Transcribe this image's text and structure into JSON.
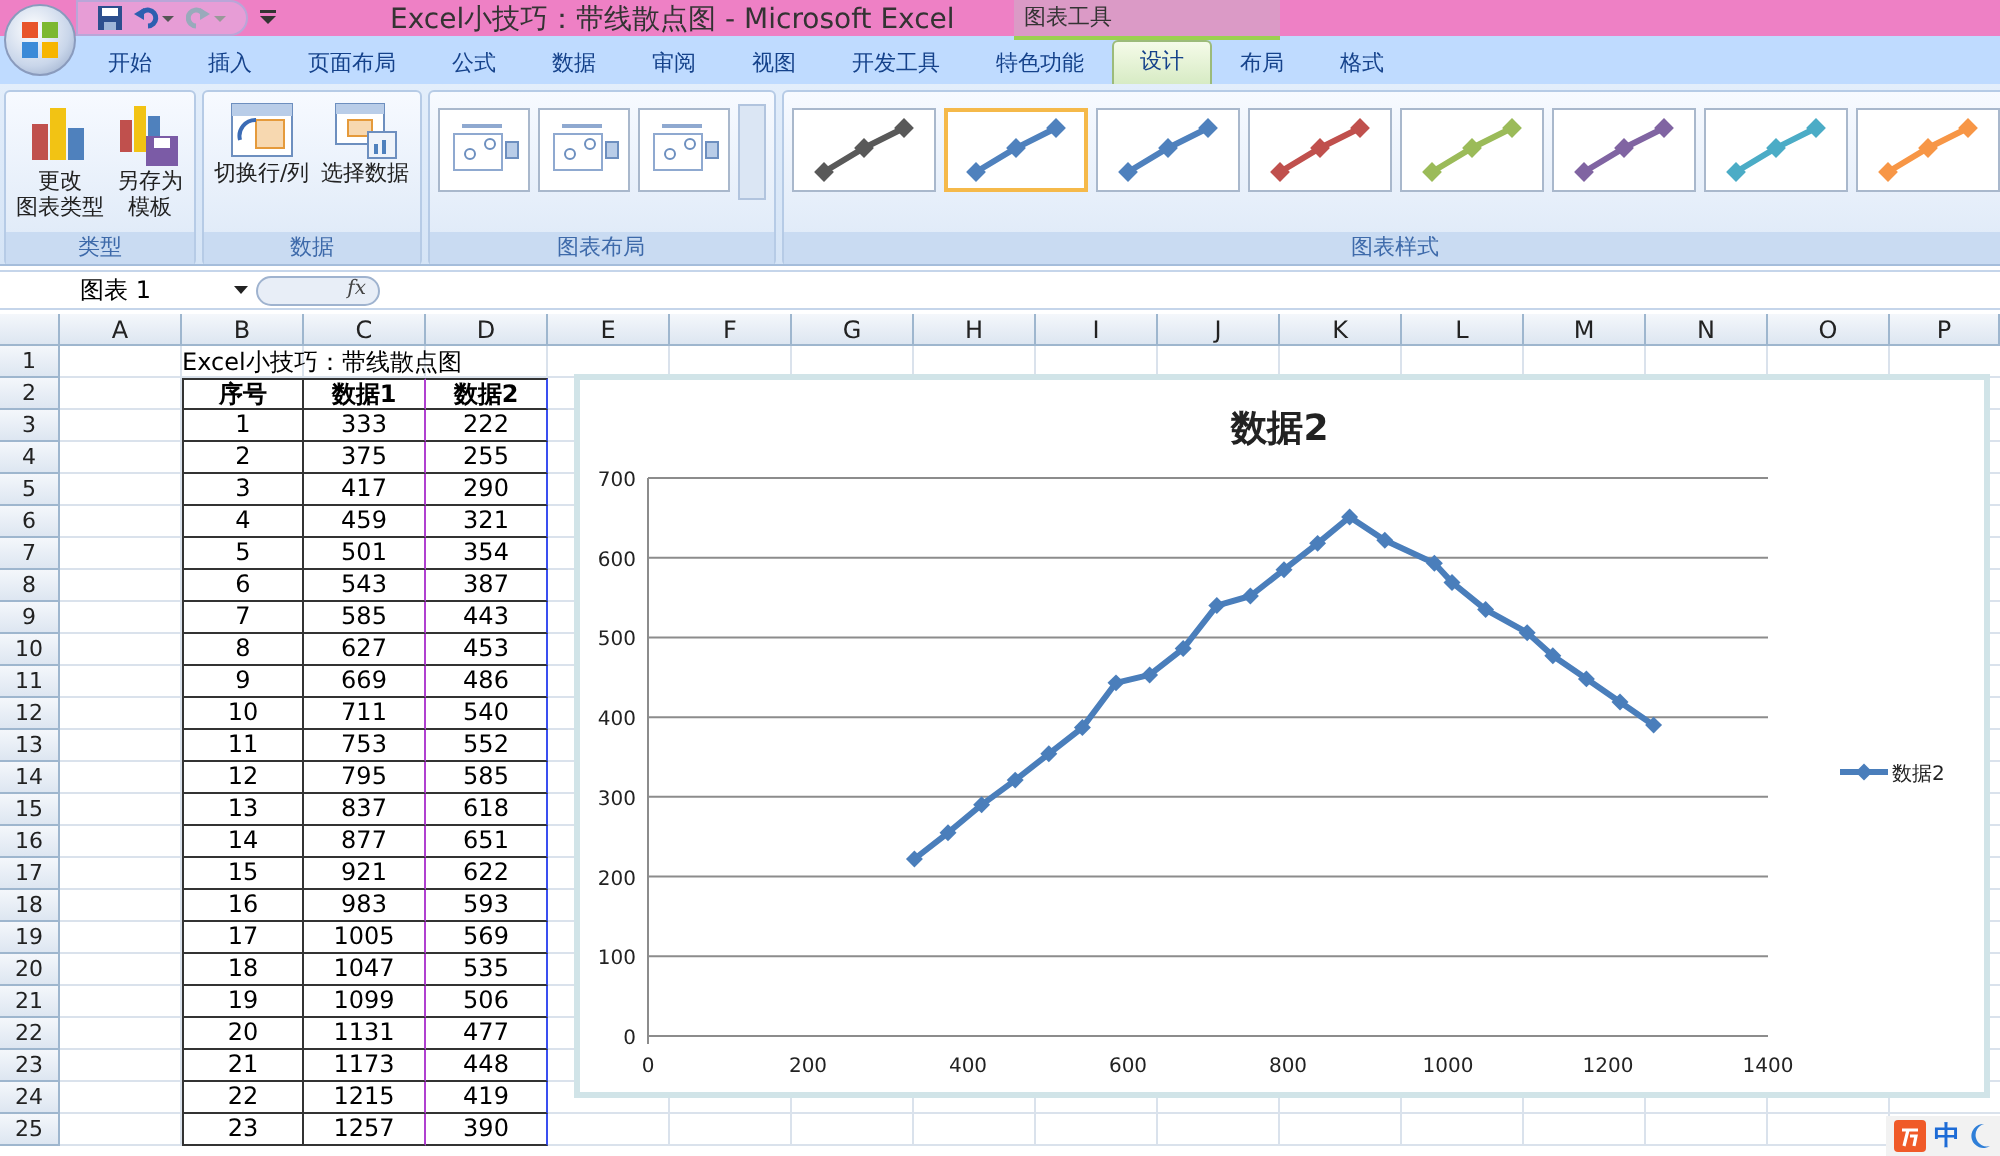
{
  "window": {
    "title": "Excel小技巧：带线散点图 - Microsoft Excel",
    "context_label": "图表工具"
  },
  "tabs": [
    {
      "label": "开始",
      "selected": false
    },
    {
      "label": "插入",
      "selected": false
    },
    {
      "label": "页面布局",
      "selected": false
    },
    {
      "label": "公式",
      "selected": false
    },
    {
      "label": "数据",
      "selected": false
    },
    {
      "label": "审阅",
      "selected": false
    },
    {
      "label": "视图",
      "selected": false
    },
    {
      "label": "开发工具",
      "selected": false
    },
    {
      "label": "特色功能",
      "selected": false
    },
    {
      "label": "设计",
      "selected": true
    },
    {
      "label": "布局",
      "selected": false
    },
    {
      "label": "格式",
      "selected": false
    }
  ],
  "ribbon": {
    "groups": [
      {
        "label": "类型",
        "kind": "buttons",
        "buttons": [
          {
            "lines": [
              "更改",
              "图表类型"
            ]
          },
          {
            "lines": [
              "另存为",
              "模板"
            ]
          }
        ]
      },
      {
        "label": "数据",
        "kind": "buttons",
        "buttons": [
          {
            "lines": [
              "切换行/列"
            ]
          },
          {
            "lines": [
              "选择数据"
            ]
          }
        ]
      },
      {
        "label": "图表布局",
        "kind": "layouts",
        "layouts": [
          {
            "selected": false
          },
          {
            "selected": false
          },
          {
            "selected": false
          }
        ]
      },
      {
        "label": "图表样式",
        "kind": "styles",
        "styles": [
          {
            "color": "#595959",
            "selected": false
          },
          {
            "color": "#4f81bd",
            "selected": true
          },
          {
            "color": "#4f81bd",
            "selected": false
          },
          {
            "color": "#c0504d",
            "selected": false
          },
          {
            "color": "#9bbb59",
            "selected": false
          },
          {
            "color": "#8064a2",
            "selected": false
          },
          {
            "color": "#4bacc6",
            "selected": false
          },
          {
            "color": "#f79646",
            "selected": false
          }
        ]
      }
    ]
  },
  "formula_bar": {
    "name_box": "图表 1",
    "fx": "fx"
  },
  "sheet": {
    "columns": [
      "A",
      "B",
      "C",
      "D",
      "E",
      "F",
      "G",
      "H",
      "I",
      "J",
      "K",
      "L",
      "M",
      "N",
      "O",
      "P"
    ],
    "row_numbers": [
      "1",
      "2",
      "3",
      "4",
      "5",
      "6",
      "7",
      "8",
      "9",
      "10",
      "11",
      "12",
      "13",
      "14",
      "15",
      "16",
      "17",
      "18",
      "19",
      "20",
      "21",
      "22",
      "23",
      "24",
      "25"
    ],
    "title_cell": "Excel小技巧：带线散点图",
    "table": {
      "columns": [
        "序号",
        "数据1",
        "数据2"
      ],
      "rows": [
        [
          "1",
          "333",
          "222"
        ],
        [
          "2",
          "375",
          "255"
        ],
        [
          "3",
          "417",
          "290"
        ],
        [
          "4",
          "459",
          "321"
        ],
        [
          "5",
          "501",
          "354"
        ],
        [
          "6",
          "543",
          "387"
        ],
        [
          "7",
          "585",
          "443"
        ],
        [
          "8",
          "627",
          "453"
        ],
        [
          "9",
          "669",
          "486"
        ],
        [
          "10",
          "711",
          "540"
        ],
        [
          "11",
          "753",
          "552"
        ],
        [
          "12",
          "795",
          "585"
        ],
        [
          "13",
          "837",
          "618"
        ],
        [
          "14",
          "877",
          "651"
        ],
        [
          "15",
          "921",
          "622"
        ],
        [
          "16",
          "983",
          "593"
        ],
        [
          "17",
          "1005",
          "569"
        ],
        [
          "18",
          "1047",
          "535"
        ],
        [
          "19",
          "1099",
          "506"
        ],
        [
          "20",
          "1131",
          "477"
        ],
        [
          "21",
          "1173",
          "448"
        ],
        [
          "22",
          "1215",
          "419"
        ],
        [
          "23",
          "1257",
          "390"
        ]
      ]
    }
  },
  "chart": {
    "chart_data": {
      "type": "line",
      "title": "数据2",
      "x": [
        333,
        375,
        417,
        459,
        501,
        543,
        585,
        627,
        669,
        711,
        753,
        795,
        837,
        877,
        921,
        983,
        1005,
        1047,
        1099,
        1131,
        1173,
        1215,
        1257
      ],
      "series": [
        {
          "name": "数据2",
          "color": "#4a7ebb",
          "marker": "diamond",
          "values": [
            222,
            255,
            290,
            321,
            354,
            387,
            443,
            453,
            486,
            540,
            552,
            585,
            618,
            651,
            622,
            593,
            569,
            535,
            506,
            477,
            448,
            419,
            390
          ]
        }
      ],
      "xlim": [
        0,
        1400
      ],
      "ylim": [
        0,
        700
      ],
      "xticks": [
        0,
        200,
        400,
        600,
        800,
        1000,
        1200,
        1400
      ],
      "yticks": [
        0,
        100,
        200,
        300,
        400,
        500,
        600,
        700
      ],
      "grid": true
    }
  },
  "ime": {
    "mode": "中"
  }
}
